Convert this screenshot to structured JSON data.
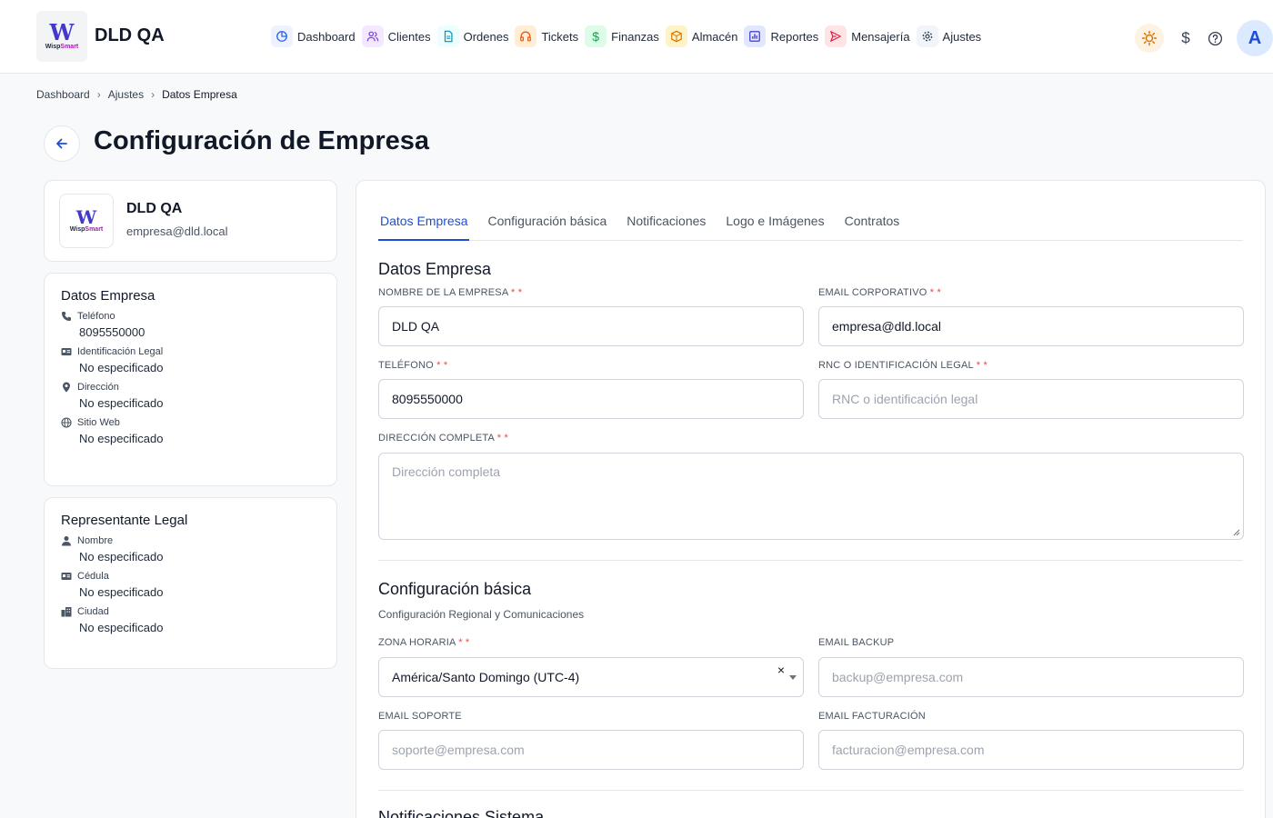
{
  "app": {
    "brand": "DLD QA",
    "logo_text": "W",
    "logo_sub_a": "Wisp",
    "logo_sub_b": "Smart",
    "avatar_letter": "A"
  },
  "nav": [
    {
      "label": "Dashboard",
      "icon": "dashboard-icon",
      "bg": "#eef2ff",
      "color": "#2563eb"
    },
    {
      "label": "Clientes",
      "icon": "users-icon",
      "bg": "#f3e8ff",
      "color": "#7c3aed"
    },
    {
      "label": "Ordenes",
      "icon": "document-icon",
      "bg": "#ecfeff",
      "color": "#0891b2"
    },
    {
      "label": "Tickets",
      "icon": "headset-icon",
      "bg": "#ffedd5",
      "color": "#ea580c"
    },
    {
      "label": "Finanzas",
      "icon": "dollar-icon",
      "bg": "#dcfce7",
      "color": "#16a34a"
    },
    {
      "label": "Almacén",
      "icon": "box-icon",
      "bg": "#fef3c7",
      "color": "#d97706"
    },
    {
      "label": "Reportes",
      "icon": "chart-icon",
      "bg": "#e0e7ff",
      "color": "#4338ca"
    },
    {
      "label": "Mensajería",
      "icon": "send-icon",
      "bg": "#ffe4e6",
      "color": "#e11d48"
    },
    {
      "label": "Ajustes",
      "icon": "gear-icon",
      "bg": "#f1f5f9",
      "color": "#334155"
    }
  ],
  "breadcrumb": [
    "Dashboard",
    "Ajustes",
    "Datos Empresa"
  ],
  "page_title": "Configuración de Empresa",
  "profile": {
    "name": "DLD QA",
    "email": "empresa@dld.local"
  },
  "company_card": {
    "title": "Datos Empresa",
    "rows": [
      {
        "label": "Teléfono",
        "value": "8095550000"
      },
      {
        "label": "Identificación Legal",
        "value": "No especificado"
      },
      {
        "label": "Dirección",
        "value": "No especificado"
      },
      {
        "label": "Sitio Web",
        "value": "No especificado"
      }
    ]
  },
  "legal_card": {
    "title": "Representante Legal",
    "rows": [
      {
        "label": "Nombre",
        "value": "No especificado"
      },
      {
        "label": "Cédula",
        "value": "No especificado"
      },
      {
        "label": "Ciudad",
        "value": "No especificado"
      }
    ]
  },
  "tabs": [
    "Datos Empresa",
    "Configuración básica",
    "Notificaciones",
    "Logo e Imágenes",
    "Contratos"
  ],
  "section_company": {
    "title": "Datos Empresa",
    "name_label": "NOMBRE DE LA EMPRESA",
    "name_value": "DLD QA",
    "email_label": "EMAIL CORPORATIVO",
    "email_value": "empresa@dld.local",
    "phone_label": "TELÉFONO",
    "phone_value": "8095550000",
    "rnc_label": "RNC O IDENTIFICACIÓN LEGAL",
    "rnc_placeholder": "RNC o identificación legal",
    "address_label": "DIRECCIÓN COMPLETA",
    "address_placeholder": "Dirección completa",
    "req": "* *"
  },
  "section_basic": {
    "title": "Configuración básica",
    "subtitle": "Configuración Regional y Comunicaciones",
    "tz_label": "ZONA HORARIA",
    "tz_value": "América/Santo Domingo (UTC-4)",
    "tz_clear": "×",
    "backup_label": "EMAIL BACKUP",
    "backup_placeholder": "backup@empresa.com",
    "support_label": "EMAIL SOPORTE",
    "support_placeholder": "soporte@empresa.com",
    "billing_label": "EMAIL FACTURACIÓN",
    "billing_placeholder": "facturacion@empresa.com"
  },
  "section_notif": {
    "title": "Notificaciones Sistema"
  }
}
